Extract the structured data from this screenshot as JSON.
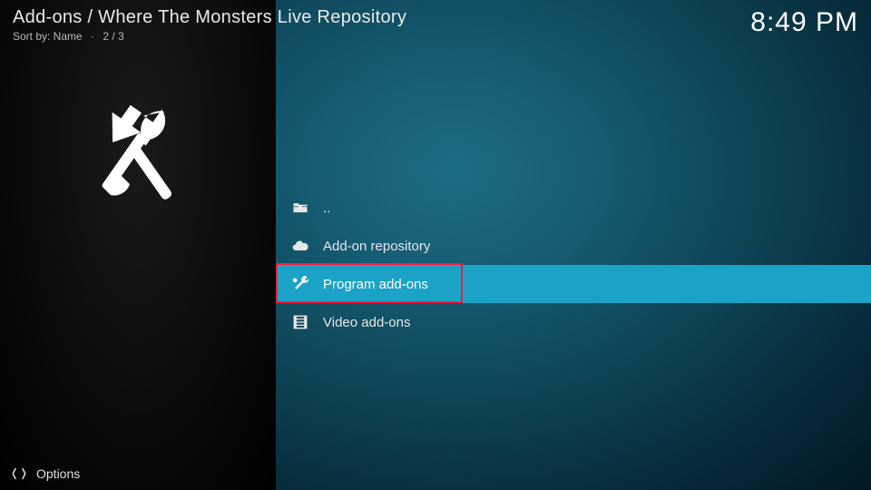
{
  "header": {
    "breadcrumb": "Add-ons / Where The Monsters Live Repository",
    "sort_label": "Sort by: Name",
    "position": "2 / 3",
    "clock": "8:49 PM"
  },
  "sidebar": {
    "icon_name": "tools-icon"
  },
  "list": {
    "items": [
      {
        "label": "..",
        "icon": "folder-up-icon",
        "selected": false
      },
      {
        "label": "Add-on repository",
        "icon": "cloud-icon",
        "selected": false
      },
      {
        "label": "Program add-ons",
        "icon": "tools-icon",
        "selected": true
      },
      {
        "label": "Video add-ons",
        "icon": "film-icon",
        "selected": false
      }
    ]
  },
  "footer": {
    "options_label": "Options"
  },
  "colors": {
    "accent": "#1aa3c6",
    "highlight": "#ff1c3c"
  }
}
